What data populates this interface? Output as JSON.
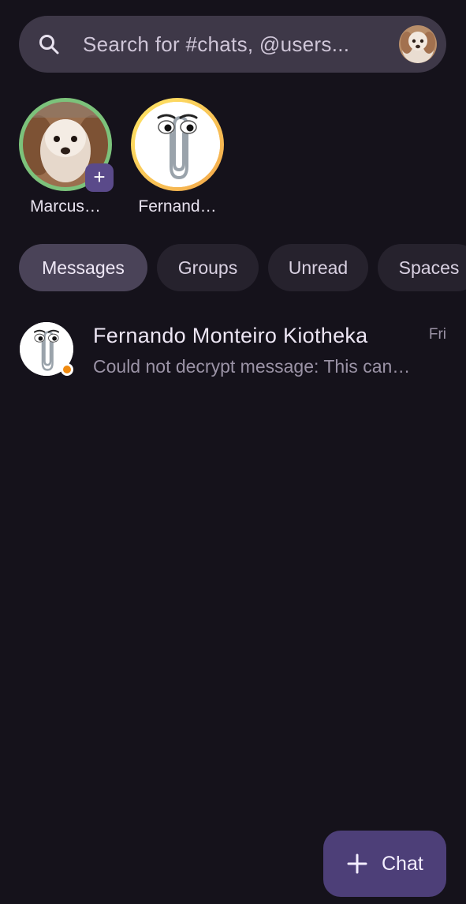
{
  "search": {
    "placeholder": "Search for #chats, @users...",
    "icon": "search-icon",
    "avatar": "user-avatar-dog"
  },
  "stories": [
    {
      "label": "Marcus…",
      "avatar": "dog-avatar",
      "ring_color": "#7cc27b",
      "badge": "+"
    },
    {
      "label": "Fernand…",
      "avatar": "clippy-avatar",
      "ring_color": "#f5d35a"
    }
  ],
  "filters": [
    {
      "label": "Messages",
      "active": true
    },
    {
      "label": "Groups",
      "active": false
    },
    {
      "label": "Unread",
      "active": false
    },
    {
      "label": "Spaces",
      "active": false
    }
  ],
  "chats": [
    {
      "name": "Fernando Monteiro Kiotheka",
      "time": "Fri",
      "preview": "Could not decrypt message: This can…",
      "avatar": "clippy-avatar",
      "presence_color": "#f08a0f"
    }
  ],
  "fab": {
    "label": "Chat",
    "icon": "plus-icon"
  },
  "colors": {
    "background": "#15121b",
    "accent": "#4d3f78",
    "search_bg": "#3e3848",
    "chip_bg": "#26222d",
    "chip_active_bg": "#4a4358"
  }
}
